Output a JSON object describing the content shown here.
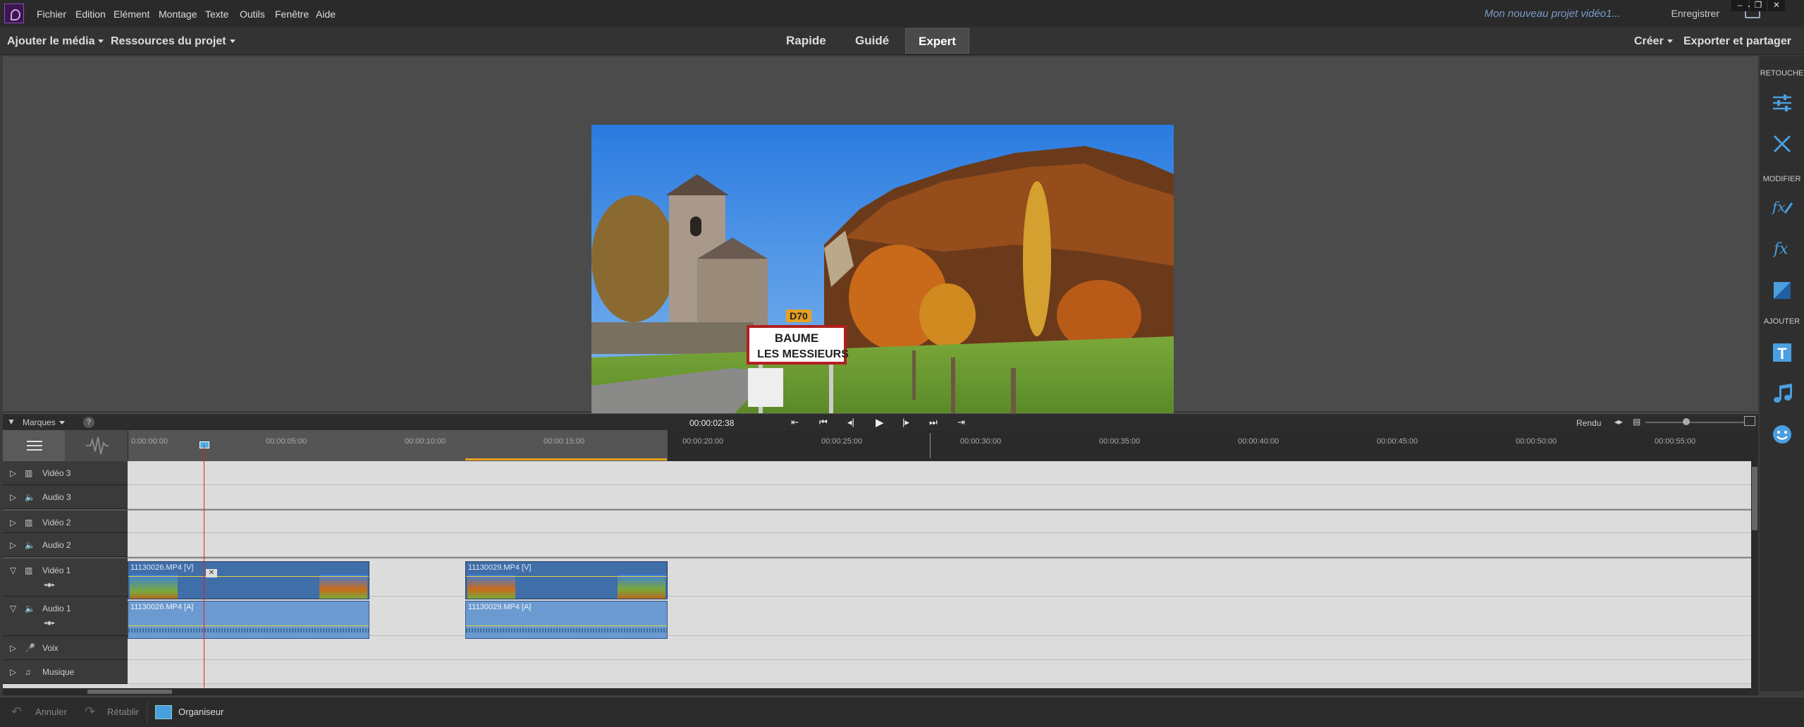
{
  "menubar": {
    "items": [
      "Fichier",
      "Edition",
      "Elément",
      "Montage",
      "Texte",
      "Outils",
      "Fenêtre",
      "Aide"
    ],
    "project_title": "Mon nouveau projet vidéo1...",
    "save_label": "Enregistrer"
  },
  "modebar": {
    "add_media": "Ajouter le média",
    "project_resources": "Ressources du projet",
    "tabs": [
      "Rapide",
      "Guidé",
      "Expert"
    ],
    "active_tab": "Expert",
    "create": "Créer",
    "export_share": "Exporter et partager"
  },
  "preview": {
    "sign_road": "D70",
    "sign_top": "BAUME",
    "sign_bottom": "LES MESSIEURS",
    "sign_prefix": "LES"
  },
  "right_panel": {
    "sections": [
      "RETOUCHE",
      "MODIFIER",
      "AJOUTER"
    ],
    "icons": [
      "adjust-sliders-icon",
      "tools-icon",
      "fx-pen-icon",
      "fx-icon",
      "transition-icon",
      "text-icon",
      "music-icon",
      "smiley-icon"
    ]
  },
  "timeline": {
    "markers_label": "Marques",
    "help": "?",
    "current_time": "00:00:02:38",
    "render_label": "Rendu",
    "ruler_ticks": [
      "0:00:00:00",
      "00:00:05:00",
      "00:00:10:00",
      "00:00:15:00",
      "00:00:20:00",
      "00:00:25:00",
      "00:00:30:00",
      "00:00:35:00",
      "00:00:40:00",
      "00:00:45:00",
      "00:00:50:00",
      "00:00:55:00"
    ],
    "tracks": [
      "Vidéo 3",
      "Audio 3",
      "Vidéo 2",
      "Audio 2",
      "Vidéo 1",
      "Audio 1",
      "Voix",
      "Musique"
    ],
    "clips": {
      "v1a": "11130026.MP4 [V]",
      "a1a": "11130026.MP4 [A]",
      "v1b": "11130029.MP4 [V]",
      "a1b": "11130029.MP4 [A]"
    }
  },
  "bottombar": {
    "undo": "Annuler",
    "redo": "Rétablir",
    "organizer": "Organiseur"
  }
}
